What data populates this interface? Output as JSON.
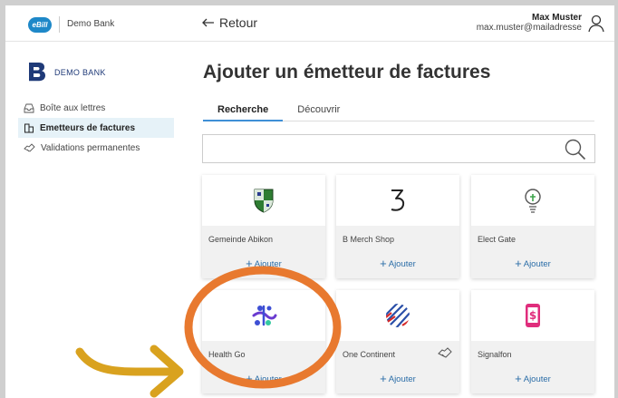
{
  "header": {
    "ebill_label": "eBill",
    "bank_name": "Demo Bank",
    "back_label": "Retour",
    "user_name": "Max Muster",
    "user_email": "max.muster@mailadresse"
  },
  "sidebar": {
    "logo_text": "DEMO BANK",
    "items": [
      {
        "label": "Boîte aux lettres",
        "icon": "inbox-icon",
        "active": false
      },
      {
        "label": "Emetteurs de factures",
        "icon": "building-icon",
        "active": true
      },
      {
        "label": "Validations permanentes",
        "icon": "handshake-icon",
        "active": false
      }
    ]
  },
  "main": {
    "title": "Ajouter un émetteur de factures",
    "tabs": [
      {
        "label": "Recherche",
        "active": true
      },
      {
        "label": "Découvrir",
        "active": false
      }
    ],
    "search": {
      "value": "",
      "placeholder": ""
    },
    "billers": [
      {
        "name": "Gemeinde Abikon",
        "add_label": "Ajouter",
        "logo": "coat-of-arms-logo"
      },
      {
        "name": "B Merch Shop",
        "add_label": "Ajouter",
        "logo": "b-merch-logo"
      },
      {
        "name": "Elect Gate",
        "add_label": "Ajouter",
        "logo": "lightbulb-logo"
      },
      {
        "name": "Health Go",
        "add_label": "Ajouter",
        "logo": "health-go-logo"
      },
      {
        "name": "One Continent",
        "add_label": "Ajouter",
        "logo": "globe-logo",
        "badge": "handshake-icon"
      },
      {
        "name": "Signalfon",
        "add_label": "Ajouter",
        "logo": "phone-dollar-logo"
      }
    ]
  },
  "colors": {
    "accent": "#1e88c8",
    "brand_navy": "#1f3a78",
    "highlight_circle": "#e8792f",
    "arrow": "#d9a21f"
  }
}
